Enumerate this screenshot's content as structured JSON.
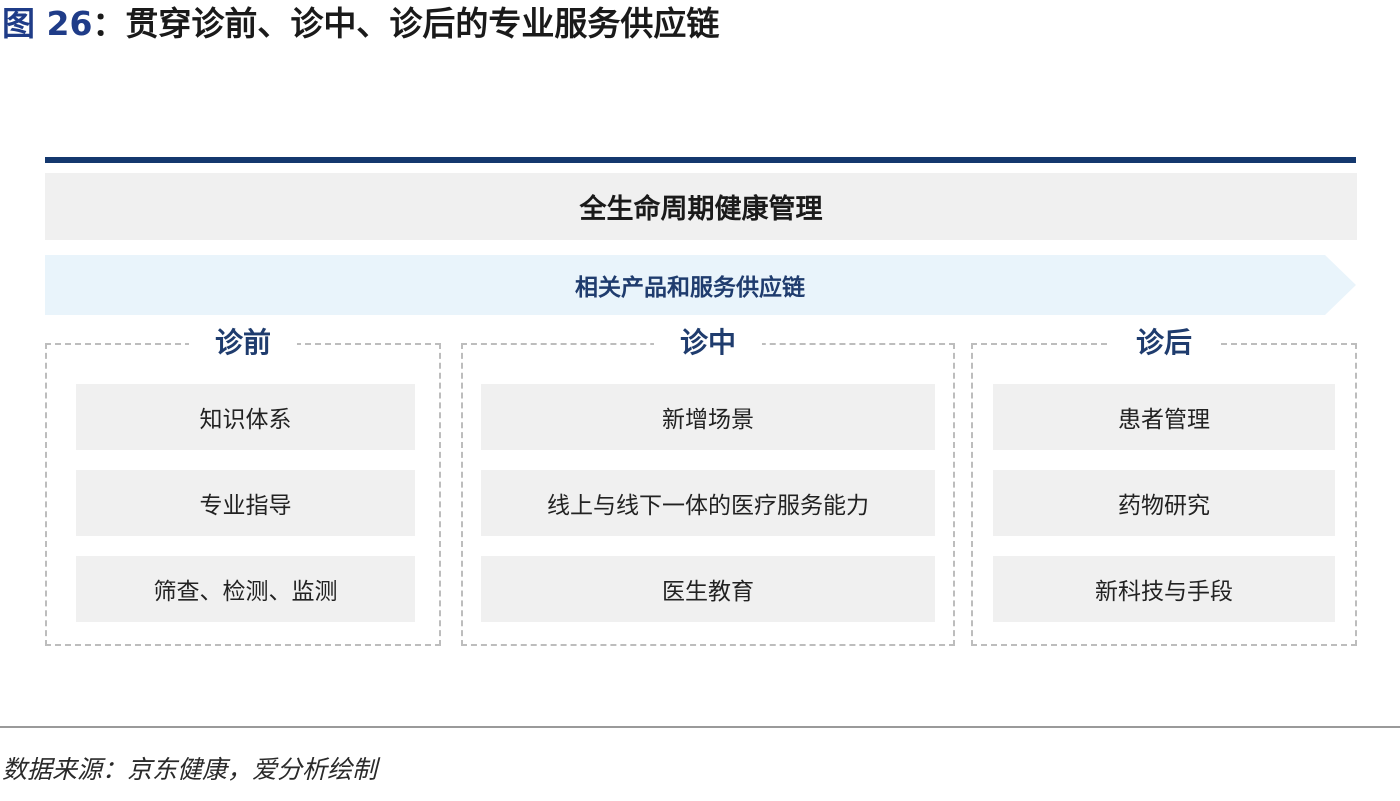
{
  "figure": {
    "title_prefix": "图 26",
    "title_rest": "：贯穿诊前、诊中、诊后的专业服务供应链"
  },
  "header_band": {
    "label": "全生命周期健康管理"
  },
  "supply_band": {
    "label": "相关产品和服务供应链",
    "fill_color": "#e9f4fb"
  },
  "phases": [
    {
      "title": "诊前",
      "items": [
        "知识体系",
        "专业指导",
        "筛查、检测、监测"
      ]
    },
    {
      "title": "诊中",
      "items": [
        "新增场景",
        "线上与线下一体的医疗服务能力",
        "医生教育"
      ]
    },
    {
      "title": "诊后",
      "items": [
        "患者管理",
        "药物研究",
        "新科技与手段"
      ]
    }
  ],
  "colors": {
    "accent_navy": "#14386e",
    "phase_title": "#1f3c6e",
    "item_bg": "#f0f0f0"
  },
  "footer": {
    "source": "数据来源：京东健康，爱分析绘制"
  }
}
